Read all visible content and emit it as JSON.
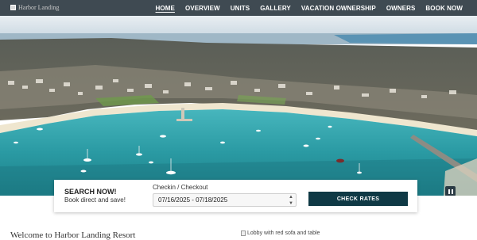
{
  "brand": {
    "logo_text": "Harbor Landing",
    "logo_icon": "broken-image-icon"
  },
  "nav": {
    "items": [
      {
        "label": "HOME",
        "active": true
      },
      {
        "label": "OVERVIEW"
      },
      {
        "label": "UNITS"
      },
      {
        "label": "GALLERY"
      },
      {
        "label": "VACATION OWNERSHIP"
      },
      {
        "label": "OWNERS"
      },
      {
        "label": "BOOK NOW"
      }
    ]
  },
  "hero": {
    "pause_icon": "pause-icon"
  },
  "booking": {
    "title": "SEARCH NOW!",
    "subtitle": "Book direct and save!",
    "date_label": "Checkin / Checkout",
    "date_value": "07/16/2025 - 07/18/2025",
    "button_label": "CHECK RATES",
    "button_color": "#0f3945"
  },
  "content": {
    "welcome_heading": "Welcome to Harbor Landing Resort",
    "image_alt": "Lobby with red sofa and table"
  }
}
